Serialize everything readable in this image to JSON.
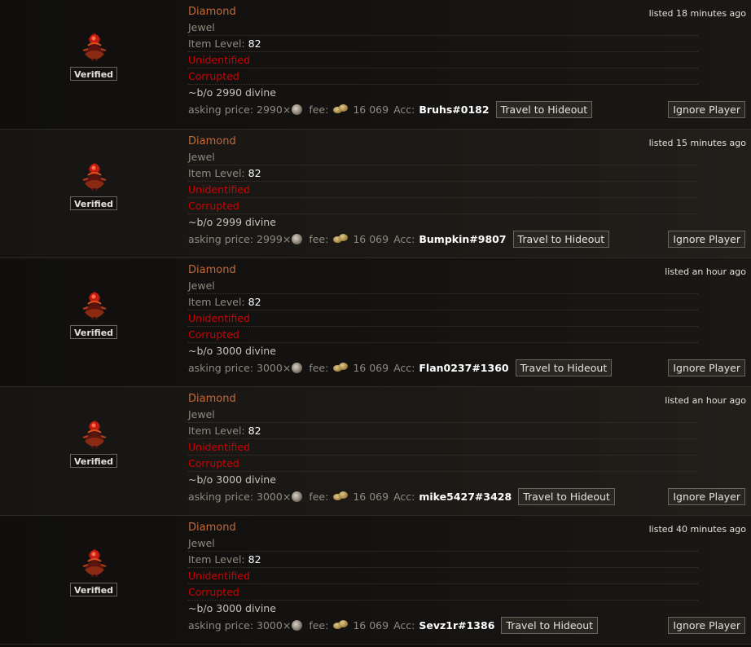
{
  "listings": [
    {
      "name": "Diamond",
      "base": "Jewel",
      "item_level_label": "Item Level:",
      "item_level": "82",
      "unidentified": "Unidentified",
      "corrupted": "Corrupted",
      "note": "~b/o 2990 divine",
      "listed": "listed 18 minutes ago",
      "verified": "Verified",
      "asking_label": "asking price:",
      "asking_value": "2990×",
      "fee_label": "fee:",
      "fee_value": "16 069",
      "acc_label": "Acc:",
      "account": "Bruhs#0182",
      "travel_label": "Travel to Hideout",
      "ignore_label": "Ignore Player"
    },
    {
      "name": "Diamond",
      "base": "Jewel",
      "item_level_label": "Item Level:",
      "item_level": "82",
      "unidentified": "Unidentified",
      "corrupted": "Corrupted",
      "note": "~b/o 2999 divine",
      "listed": "listed 15 minutes ago",
      "verified": "Verified",
      "asking_label": "asking price:",
      "asking_value": "2999×",
      "fee_label": "fee:",
      "fee_value": "16 069",
      "acc_label": "Acc:",
      "account": "Bumpkin#9807",
      "travel_label": "Travel to Hideout",
      "ignore_label": "Ignore Player"
    },
    {
      "name": "Diamond",
      "base": "Jewel",
      "item_level_label": "Item Level:",
      "item_level": "82",
      "unidentified": "Unidentified",
      "corrupted": "Corrupted",
      "note": "~b/o 3000 divine",
      "listed": "listed an hour ago",
      "verified": "Verified",
      "asking_label": "asking price:",
      "asking_value": "3000×",
      "fee_label": "fee:",
      "fee_value": "16 069",
      "acc_label": "Acc:",
      "account": "Flan0237#1360",
      "travel_label": "Travel to Hideout",
      "ignore_label": "Ignore Player"
    },
    {
      "name": "Diamond",
      "base": "Jewel",
      "item_level_label": "Item Level:",
      "item_level": "82",
      "unidentified": "Unidentified",
      "corrupted": "Corrupted",
      "note": "~b/o 3000 divine",
      "listed": "listed an hour ago",
      "verified": "Verified",
      "asking_label": "asking price:",
      "asking_value": "3000×",
      "fee_label": "fee:",
      "fee_value": "16 069",
      "acc_label": "Acc:",
      "account": "mike5427#3428",
      "travel_label": "Travel to Hideout",
      "ignore_label": "Ignore Player"
    },
    {
      "name": "Diamond",
      "base": "Jewel",
      "item_level_label": "Item Level:",
      "item_level": "82",
      "unidentified": "Unidentified",
      "corrupted": "Corrupted",
      "note": "~b/o 3000 divine",
      "listed": "listed 40 minutes ago",
      "verified": "Verified",
      "asking_label": "asking price:",
      "asking_value": "3000×",
      "fee_label": "fee:",
      "fee_value": "16 069",
      "acc_label": "Acc:",
      "account": "Sevz1r#1386",
      "travel_label": "Travel to Hideout",
      "ignore_label": "Ignore Player"
    }
  ],
  "icons": {
    "item": "diamond-jewel-icon",
    "currency": "divine-orb-icon",
    "fee": "gold-coins-icon"
  },
  "colors": {
    "item_name": "#c26a3a",
    "unidentified": "#d20000",
    "corrupted": "#d20000"
  }
}
